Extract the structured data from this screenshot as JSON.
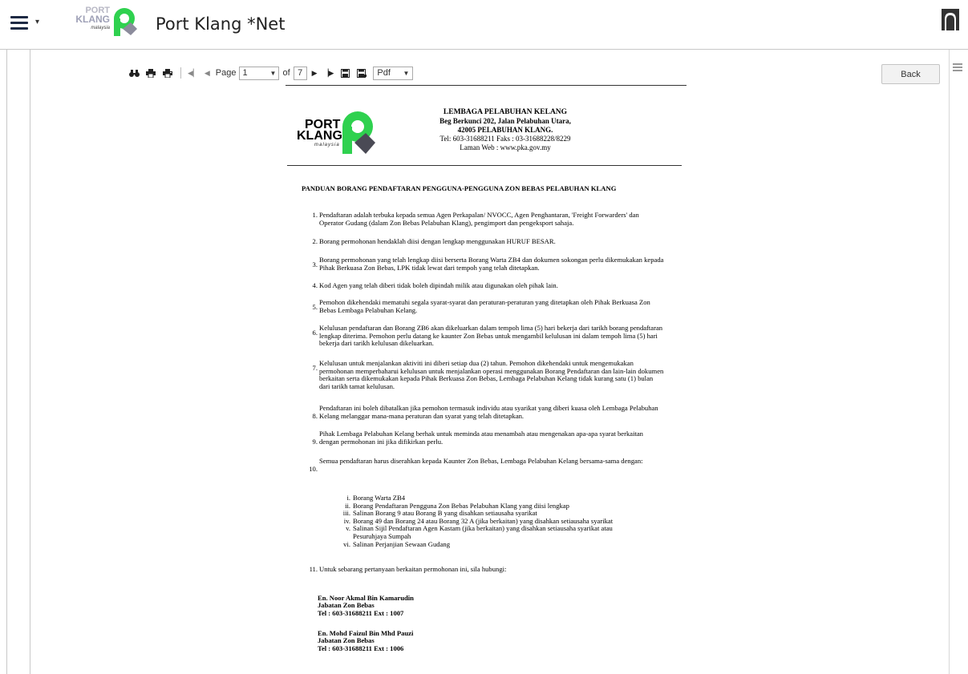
{
  "header": {
    "app_title": "Port Klang *Net",
    "logo": {
      "line1": "PORT",
      "line2": "KLANG",
      "line3": "malaysia"
    }
  },
  "toolbar": {
    "page_label": "Page",
    "page_value": "1",
    "of_label": "of",
    "total_pages": "7",
    "format_value": "Pdf"
  },
  "back_button": "Back",
  "document": {
    "logo": {
      "line1": "PORT",
      "line2": "KLANG",
      "line3": "malaysia"
    },
    "letterhead": {
      "org": "LEMBAGA PELABUHAN KELANG",
      "address1": "Beg Berkunci 202, Jalan Pelabuhan Utara,",
      "address2": "42005 PELABUHAN KLANG.",
      "tel": "Tel: 603-31688211 Faks : 03-31688228/8229",
      "web": "Laman Web : www.pka.gov.my"
    },
    "heading": "PANDUAN BORANG PENDAFTARAN PENGGUNA-PENGGUNA ZON BEBAS PELABUHAN KLANG",
    "items": [
      {
        "num": "1.",
        "text": "Pendaftaran adalah terbuka kepada semua Agen Perkapalan/ NVOCC, Agen Penghantaran, 'Freight Forwarders' dan Operator Gudang (dalam Zon Bebas Pelabuhan Klang), pengimport dan pengeksport sahaja."
      },
      {
        "num": "2.",
        "text": "Borang permohonan hendaklah diisi dengan lengkap menggunakan HURUF BESAR."
      },
      {
        "num": "3.",
        "text": "Borang permohonan yang telah lengkap diisi berserta Borang Warta ZB4 dan dokumen sokongan perlu dikemukakan kepada Pihak Berkuasa Zon Bebas, LPK tidak lewat dari tempoh yang telah ditetapkan."
      },
      {
        "num": "4.",
        "text": "Kod Agen yang telah diberi tidak boleh dipindah milik atau digunakan oleh pihak lain."
      },
      {
        "num": "5.",
        "text": "Pemohon dikehendaki mematuhi segala syarat-syarat dan peraturan-peraturan yang ditetapkan oleh Pihak Berkuasa Zon Bebas Lembaga Pelabuhan Kelang."
      },
      {
        "num": "6.",
        "text": "Kelulusan pendaftaran dan Borang ZB6 akan dikeluarkan dalam tempoh lima (5) hari bekerja dari tarikh borang pendaftaran lengkap diterima. Pemohon perlu datang ke kaunter Zon Bebas untuk mengambil kelulusan ini dalam tempoh lima (5) hari bekerja dari tarikh kelulusan dikeluarkan."
      },
      {
        "num": "7.",
        "text": "Kelulusan untuk menjalankan aktiviti ini diberi setiap dua (2) tahun. Pemohon dikehendaki untuk mengemukakan permohonan memperbaharui kelulusan untuk menjalankan operasi menggunakan Borang Pendaftaran dan lain-lain dokumen berkaitan serta dikemukakan kepada Pihak Berkuasa Zon Bebas, Lembaga Pelabuhan Kelang tidak kurang satu (1) bulan dari tarikh tamat kelulusan."
      },
      {
        "num": "8.",
        "text": "Pendaftaran ini boleh dibatalkan jika pemohon termasuk individu atau syarikat yang diberi kuasa oleh Lembaga Pelabuhan Kelang melanggar mana-mana peraturan dan syarat yang telah ditetapkan."
      },
      {
        "num": "9.",
        "text": "Pihak Lembaga Pelabuhan Kelang berhak untuk meminda atau menambah atau mengenakan apa-apa syarat berkaitan dengan permohonan ini jika difikirkan perlu."
      },
      {
        "num": "10.",
        "text": "Semua pendaftaran harus diserahkan kepada Kaunter Zon Bebas, Lembaga Pelabuhan Kelang bersama-sama dengan:"
      },
      {
        "num": "11.",
        "text": "Untuk sebarang pertanyaan berkaitan permohonan ini, sila hubungi:"
      }
    ],
    "subitems": [
      {
        "num": "i.",
        "text": "Borang Warta ZB4"
      },
      {
        "num": "ii.",
        "text": "Borang Pendaftaran Pengguna Zon Bebas Pelabuhan Klang yang diisi lengkap"
      },
      {
        "num": "iii.",
        "text": "Salinan Borang 9 atau Borang B yang disahkan setiausaha syarikat"
      },
      {
        "num": "iv.",
        "text": "Borang 49 dan Borang 24 atau Borang 32 A (jika berkaitan) yang disahkan setiausaha syarikat"
      },
      {
        "num": "v.",
        "text": "Salinan Sijil Pendaftaran Agen Kastam (jika berkaitan) yang disahkan setiausaha syarikat atau"
      },
      {
        "num": "",
        "text": "Pesuruhjaya Sumpah"
      },
      {
        "num": "vi.",
        "text": "Salinan Perjanjian Sewaan Gudang"
      }
    ],
    "contacts": [
      {
        "name": "En. Noor Akmal Bin Kamarudin",
        "dept": "Jabatan Zon Bebas",
        "tel": "Tel : 603-31688211 Ext : 1007"
      },
      {
        "name": "En. Mohd Faizul Bin Mhd Pauzi",
        "dept": "Jabatan Zon Bebas",
        "tel": "Tel : 603-31688211 Ext : 1006"
      }
    ]
  }
}
